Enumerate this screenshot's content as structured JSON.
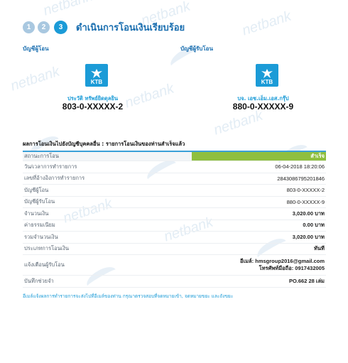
{
  "watermark": {
    "text": "netbank"
  },
  "steps": {
    "items": [
      {
        "label": "1"
      },
      {
        "label": "2"
      },
      {
        "label": "3"
      }
    ],
    "title": "ดำเนินการโอนเงินเรียบร้อย"
  },
  "from_account": {
    "header": "บัญชีผู้โอน",
    "bank": "KTB",
    "name": "ประวัติ ทรัพย์ยิดดุลยิน",
    "number": "803-0-XXXXX-2"
  },
  "to_account": {
    "header": "บัญชีผู้รับโอน",
    "bank": "KTB",
    "name": "บจ. เอช.เอ็ม.เอส.กรุ๊ป",
    "number": "880-0-XXXXX-9"
  },
  "result": {
    "title": "ผลการโอนเงินไปยังบัญชีบุคคลอื่น : รายการโอนเงินของท่านสำเร็จแล้ว",
    "rows": [
      {
        "label": "สถานะการโอน",
        "value": "สำเร็จ"
      },
      {
        "label": "วัน/เวลาการทำรายการ",
        "value": "06-04-2018 18:20:06"
      },
      {
        "label": "เลขที่อ้างอิงการทำรายการ",
        "value": "2843086795201846"
      },
      {
        "label": "บัญชีผู้โอน",
        "value": "803-0-XXXXX-2"
      },
      {
        "label": "บัญชีผู้รับโอน",
        "value": "880-0-XXXXX-9"
      },
      {
        "label": "จำนวนเงิน",
        "value": "3,020.00 บาท"
      },
      {
        "label": "ค่าธรรมเนียม",
        "value": "0.00 บาท"
      },
      {
        "label": "รวมจำนวนเงิน",
        "value": "3,020.00 บาท"
      },
      {
        "label": "ประเภทการโอนเงิน",
        "value": "ทันที"
      },
      {
        "label": "แจ้งเตือนผู้รับโอน",
        "value": "อีเมล์: hmsgroup2016@gmail.com",
        "value2": "โทรศัพท์มือถือ: 0917432005"
      },
      {
        "label": "บันทึกช่วยจำ",
        "value": "PO.662 28 เล่ม"
      }
    ]
  },
  "footer_note": "อีเมล์แจ้งผลการทำรายการจะส่งไปที่อีเมล์ของท่าน กรุณาตรวจสอบที่จดหมายเข้า, จดหมายขยะ และถังขยะ",
  "colors": {
    "accent": "#1b9bd7",
    "title_blue": "#1b6fb0",
    "success_green": "#8fbf3f"
  }
}
